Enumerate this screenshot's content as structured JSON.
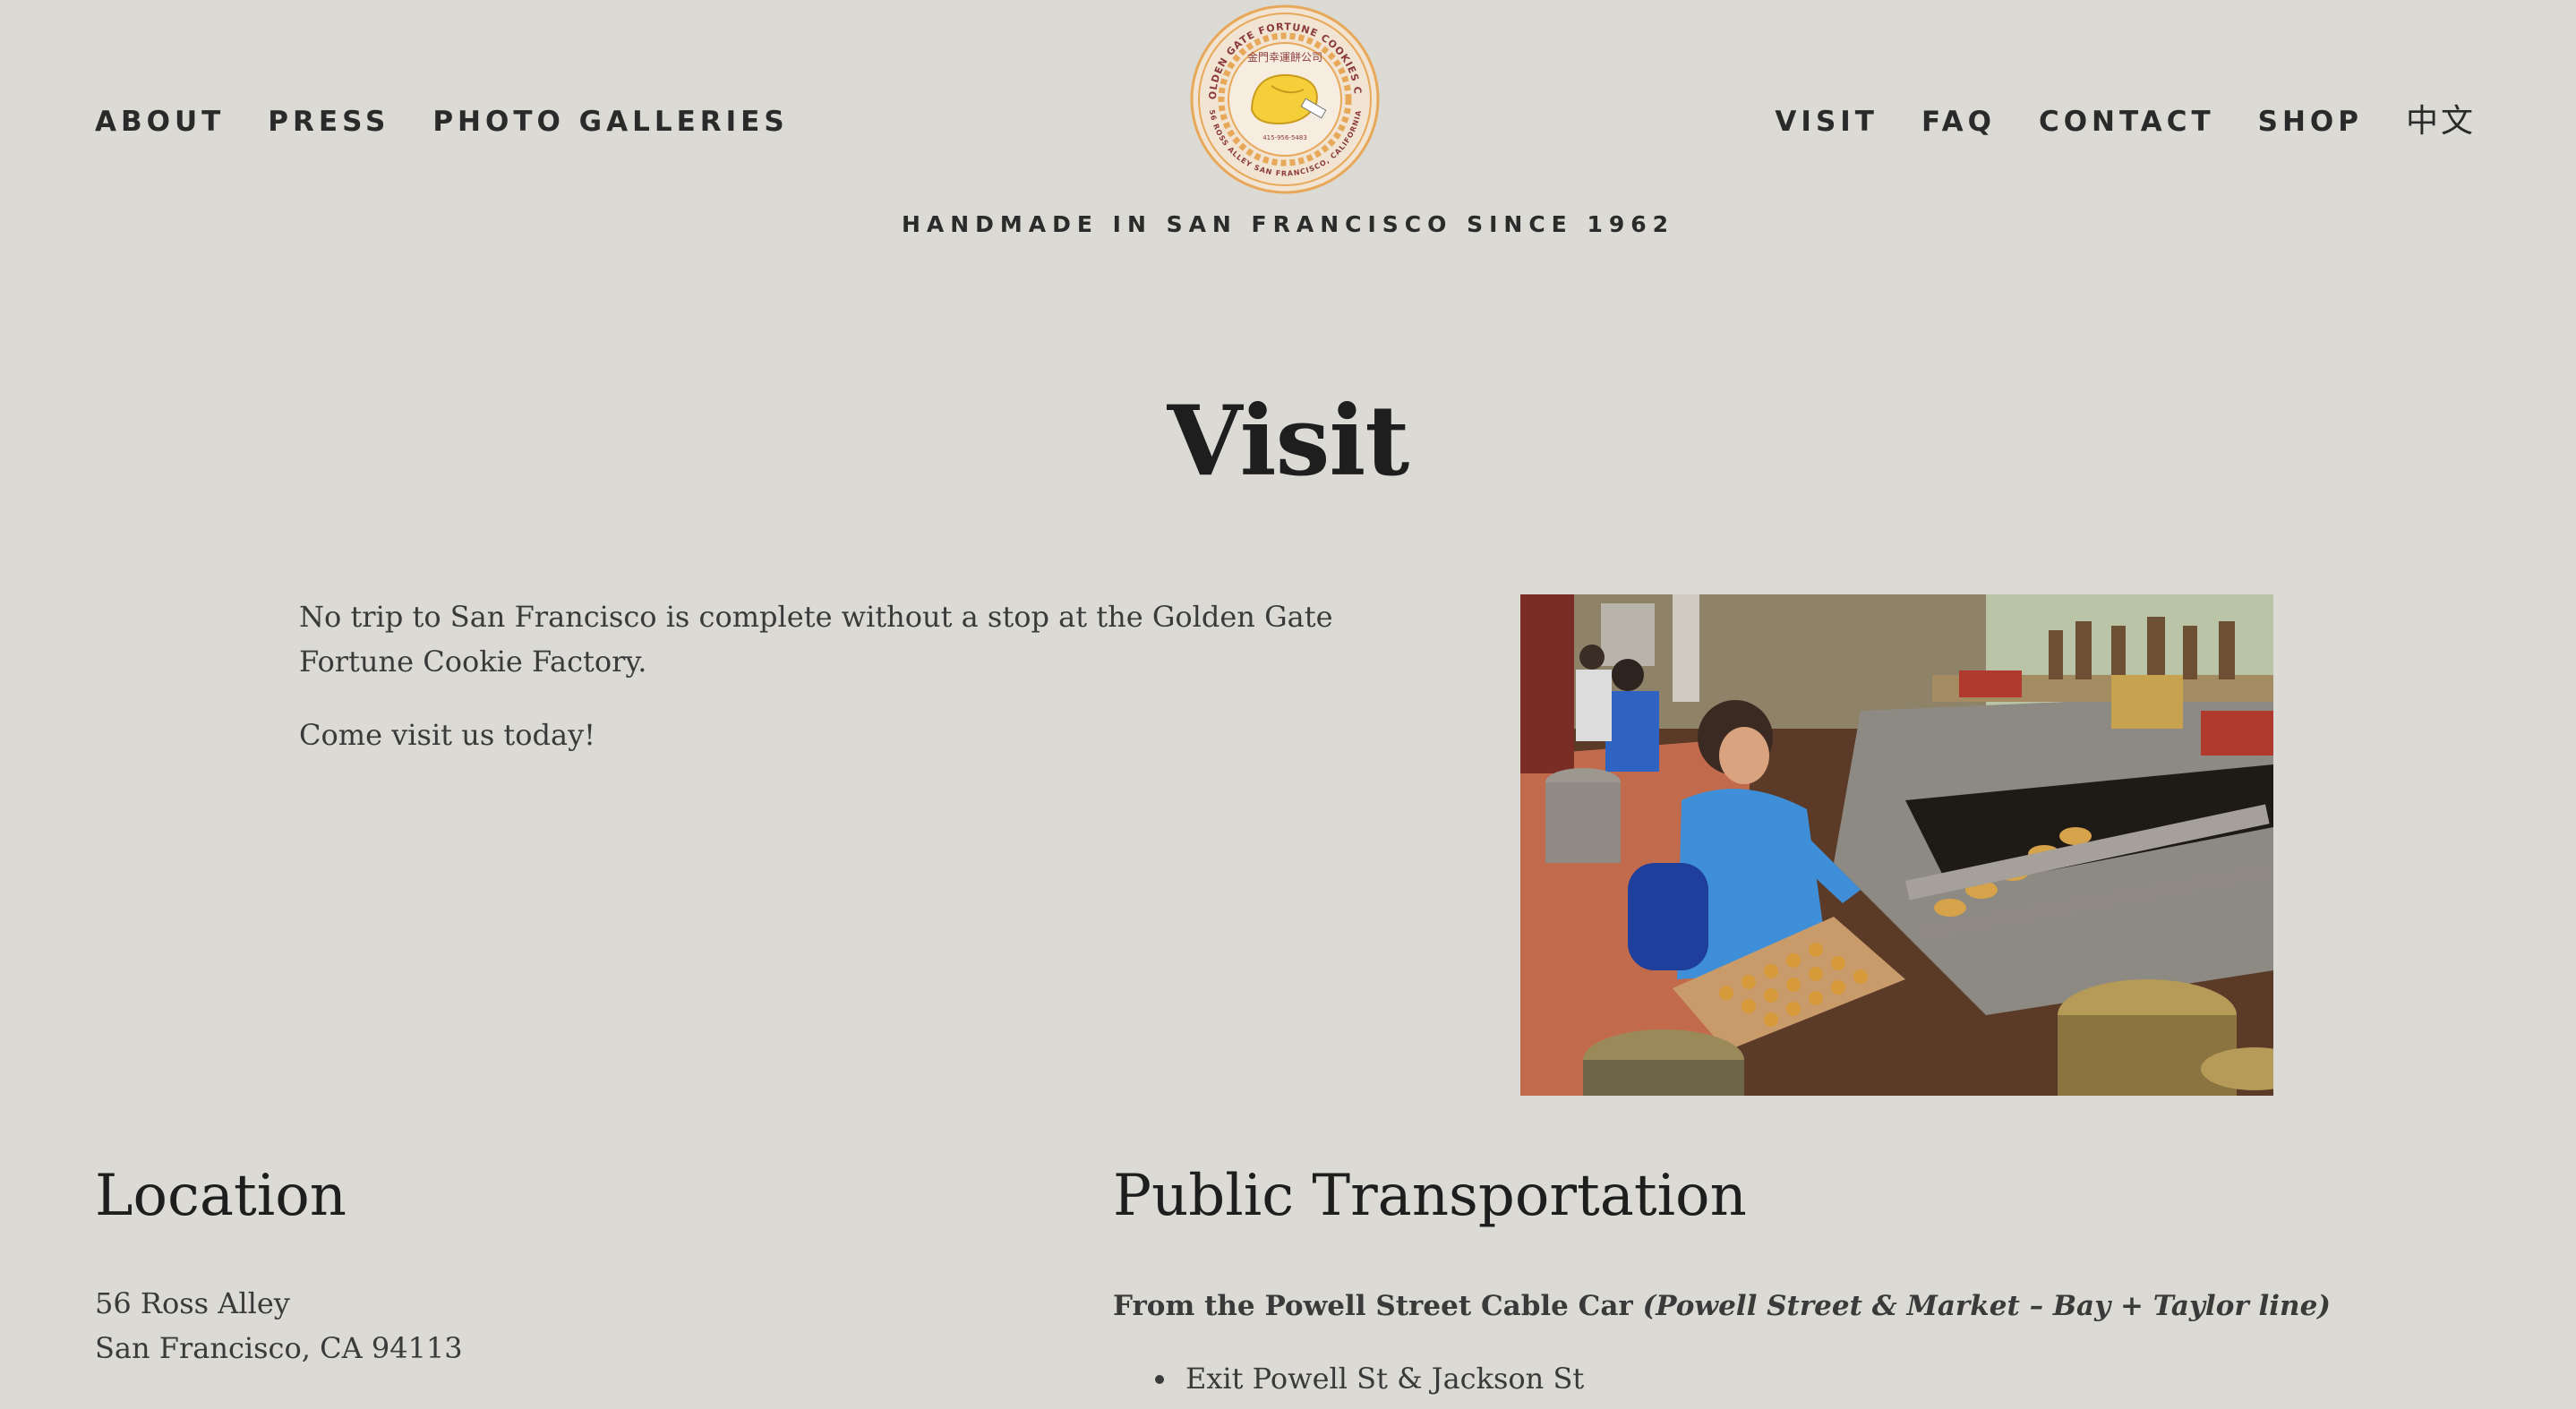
{
  "nav": {
    "left": [
      {
        "label": "ABOUT"
      },
      {
        "label": "PRESS"
      },
      {
        "label": "PHOTO GALLERIES"
      }
    ],
    "right": [
      {
        "label": "VISIT"
      },
      {
        "label": "FAQ"
      },
      {
        "label": "CONTACT"
      },
      {
        "label": "SHOP"
      },
      {
        "label": "中文"
      }
    ]
  },
  "logo": {
    "ring_text": "GOLDEN GATE FORTUNE COOKIES CO.",
    "address_text": "56 ROSS ALLEY SAN FRANCISCO, CALIFORNIA",
    "chinese_text": "金門幸運餅公司",
    "phone_text": "415-956-5483",
    "colors": {
      "ring": "#e8a85a",
      "cookie": "#f4cf3a",
      "inner": "#f3e6d5",
      "text": "#8b3a3a"
    }
  },
  "tagline": "HANDMADE IN SAN FRANCISCO SINCE 1962",
  "page": {
    "title": "Visit",
    "intro": [
      "No trip to San Francisco is complete without a stop at the Golden Gate Fortune Cookie Factory.",
      "Come visit us today!"
    ],
    "photo_icon": "fortune-cookie-factory-photo"
  },
  "location": {
    "heading": "Location",
    "address_line1": "56 Ross Alley",
    "address_line2": "San Francisco, CA 94113"
  },
  "transit": {
    "heading": "Public Transportation",
    "sub_bold": "From the Powell Street Cable Car ",
    "sub_italic": "(Powell Street & Market – Bay + Taylor line)",
    "steps": [
      "Exit Powell St & Jackson St"
    ]
  },
  "colors": {
    "background": "#dbdad5",
    "text": "#2b2b2b"
  }
}
